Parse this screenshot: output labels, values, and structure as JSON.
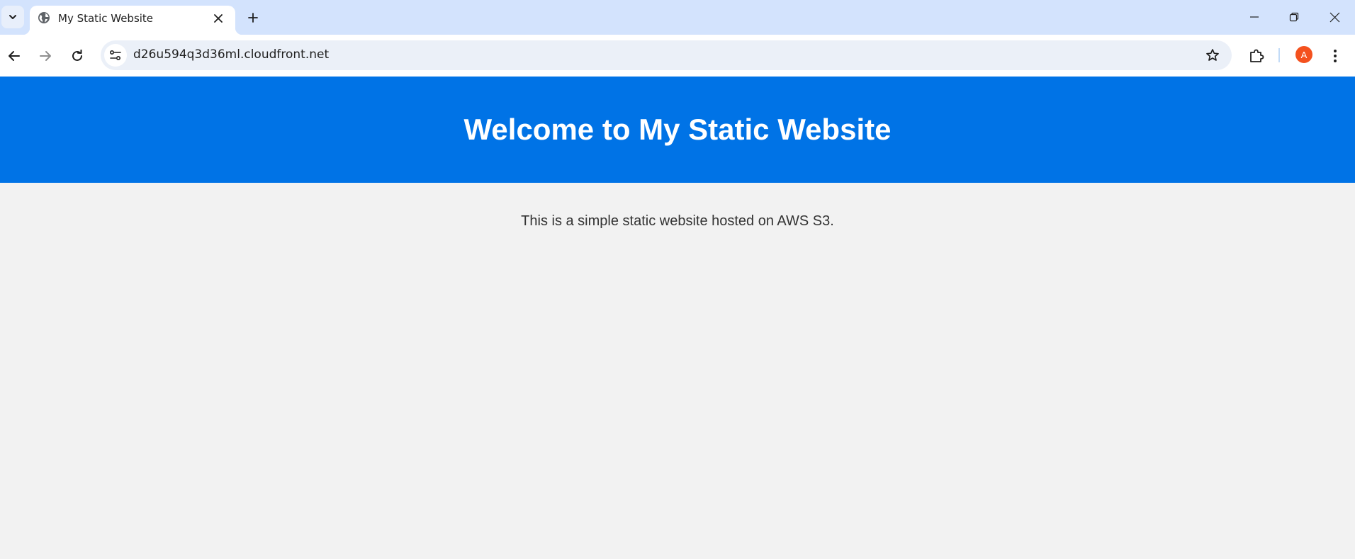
{
  "browser": {
    "tab": {
      "title": "My Static Website",
      "favicon": "globe-icon"
    },
    "address_bar": {
      "url": "d26u594q3d36ml.cloudfront.net"
    },
    "profile": {
      "initial": "A",
      "color": "#f4511e"
    },
    "icons": {
      "tab_search": "chevron-down-icon",
      "close_tab": "close-icon",
      "new_tab": "plus-icon",
      "back": "arrow-left-icon",
      "forward": "arrow-right-icon",
      "reload": "reload-icon",
      "site_info": "tune-icon",
      "bookmark": "star-icon",
      "extensions": "puzzle-icon",
      "menu": "kebab-menu-icon",
      "minimize": "minimize-icon",
      "restore": "restore-icon",
      "close_window": "close-icon"
    }
  },
  "page": {
    "header": {
      "title": "Welcome to My Static Website",
      "background": "#0073e6",
      "text_color": "#ffffff"
    },
    "body_text": "This is a simple static website hosted on AWS S3.",
    "background": "#f2f2f2"
  }
}
